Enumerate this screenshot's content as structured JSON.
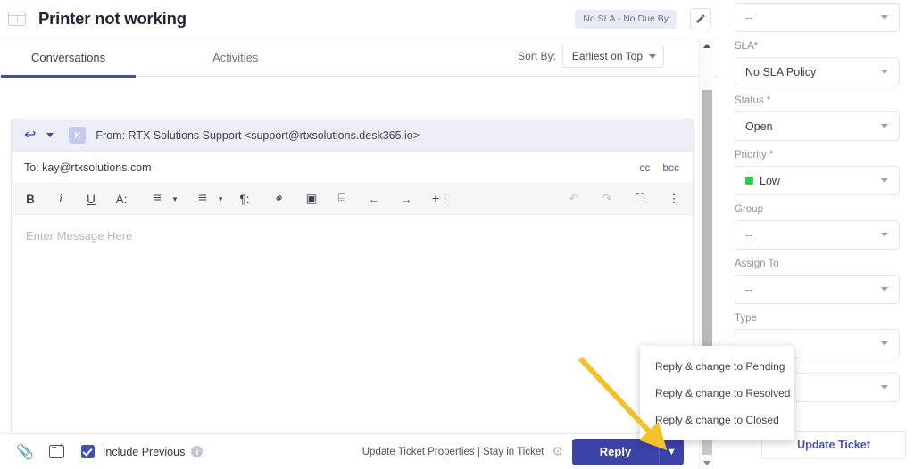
{
  "header": {
    "icon": "ticket-panel-icon",
    "title": "Printer not working",
    "sla_chip": "No SLA - No Due By",
    "edit_icon": "pencil-icon"
  },
  "tabs": {
    "items": [
      {
        "label": "Conversations",
        "active": true
      },
      {
        "label": "Activities",
        "active": false
      }
    ],
    "sort": {
      "label": "Sort By:",
      "value": "Earliest on Top"
    }
  },
  "composer": {
    "reply_icon": "reply-arrow-icon",
    "dropdown_icon": "chevron-down-icon",
    "avatar_initial": "K",
    "from_line": "From: RTX Solutions Support <support@rtxsolutions.desk365.io>",
    "to_line": "To: kay@rtxsolutions.com",
    "cc_label": "cc",
    "bcc_label": "bcc",
    "placeholder": "Enter Message Here",
    "toolbar": [
      {
        "name": "bold-icon",
        "glyph": "B"
      },
      {
        "name": "italic-icon",
        "glyph": "i"
      },
      {
        "name": "underline-icon",
        "glyph": "U"
      },
      {
        "name": "font-style-icon",
        "glyph": "A:"
      },
      {
        "name": "numbered-list-icon",
        "glyph": "≣"
      },
      {
        "name": "numbered-list-dropdown-icon",
        "glyph": "▾"
      },
      {
        "name": "bullet-list-icon",
        "glyph": "≣"
      },
      {
        "name": "bullet-list-dropdown-icon",
        "glyph": "▾"
      },
      {
        "name": "paragraph-format-icon",
        "glyph": "¶:"
      },
      {
        "name": "link-icon",
        "glyph": "⚭"
      },
      {
        "name": "image-icon",
        "glyph": "▣"
      },
      {
        "name": "table-icon",
        "glyph": "⌸"
      },
      {
        "name": "outdent-icon",
        "glyph": "←"
      },
      {
        "name": "indent-icon",
        "glyph": "→"
      },
      {
        "name": "insert-more-icon",
        "glyph": "+⋮"
      },
      {
        "name": "undo-icon",
        "glyph": "↶"
      },
      {
        "name": "redo-icon",
        "glyph": "↷"
      },
      {
        "name": "fullscreen-icon",
        "glyph": "⛶"
      },
      {
        "name": "more-options-icon",
        "glyph": "⋮"
      }
    ]
  },
  "bottom_bar": {
    "attach_icon": "paperclip-icon",
    "canned_response_icon": "insert-canned-response-icon",
    "include_previous_label": "Include Previous",
    "include_previous_checked": true,
    "info_icon": "info-icon",
    "footer_note": "Update Ticket Properties | Stay in Ticket",
    "gear_icon": "gear-icon",
    "reply_label": "Reply",
    "reply_split_icon": "chevron-down-icon",
    "reply_color": "#3b42a8"
  },
  "reply_menu": {
    "items": [
      "Reply & change to Pending",
      "Reply & change to Resolved",
      "Reply & change to Closed"
    ]
  },
  "annotation": {
    "arrow_color": "#f5c12b",
    "points_to": "reply-split-chevron"
  },
  "scrollbar": {
    "up_icon": "scroll-up-arrow",
    "down_icon": "scroll-down-arrow"
  },
  "properties": {
    "fields": [
      {
        "label": "",
        "value": "--",
        "dim": true,
        "swatch": null
      },
      {
        "label": "SLA*",
        "value": "No SLA Policy",
        "dim": false,
        "swatch": null
      },
      {
        "label": "Status *",
        "value": "Open",
        "dim": false,
        "swatch": null
      },
      {
        "label": "Priority *",
        "value": "Low",
        "dim": false,
        "swatch": "#2ecc4a"
      },
      {
        "label": "Group",
        "value": "--",
        "dim": true,
        "swatch": null
      },
      {
        "label": "Assign To",
        "value": "--",
        "dim": true,
        "swatch": null
      },
      {
        "label": "Type",
        "value": "",
        "dim": true,
        "swatch": null
      },
      {
        "label": "",
        "value": "",
        "dim": true,
        "swatch": null
      }
    ],
    "update_button": "Update Ticket"
  }
}
